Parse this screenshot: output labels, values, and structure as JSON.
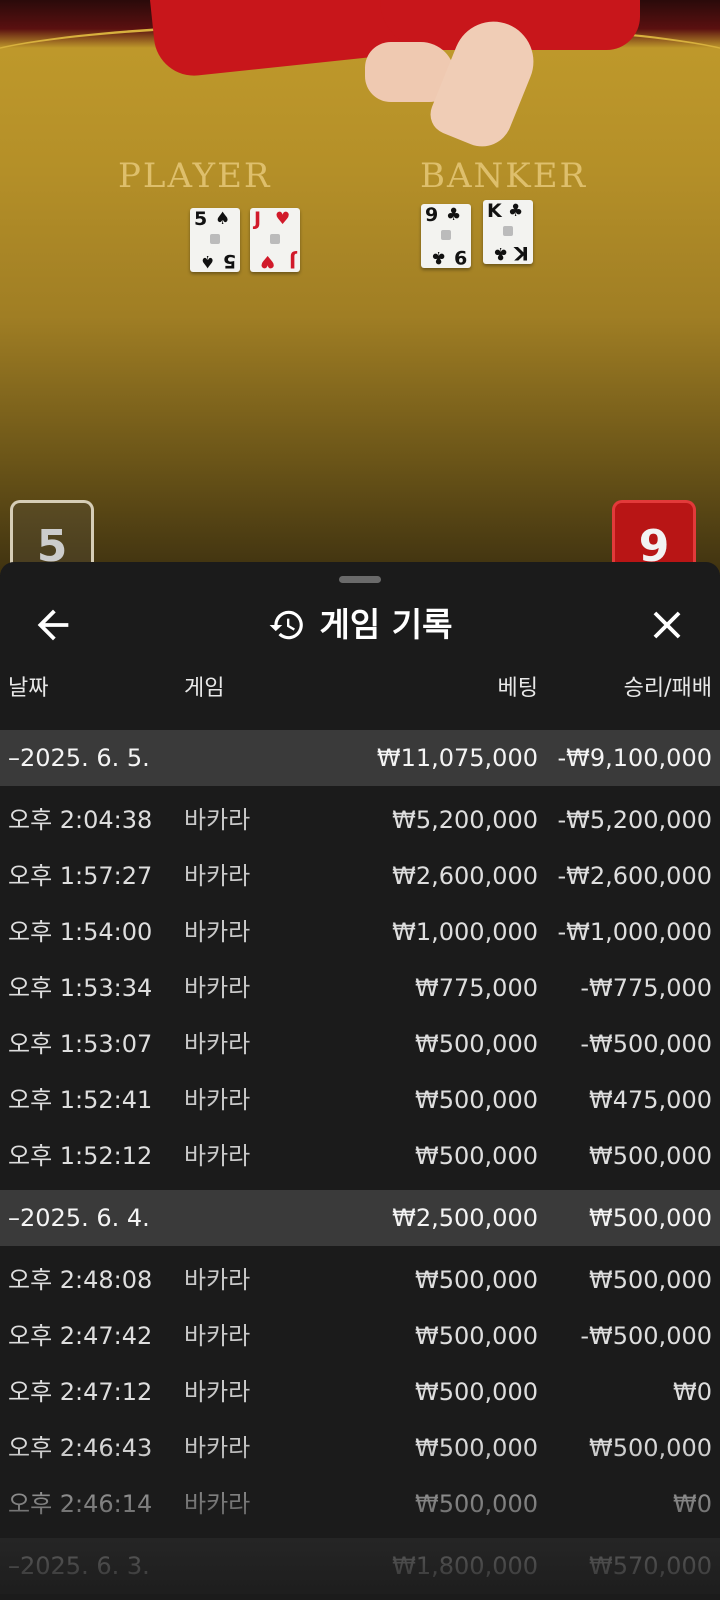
{
  "video": {
    "player_label": "PLAYER",
    "banker_label": "BANKER",
    "player_cards": [
      {
        "rank": "5",
        "suit": "♠",
        "color": "black"
      },
      {
        "rank": "J",
        "suit": "♥",
        "color": "red"
      }
    ],
    "banker_cards": [
      {
        "rank": "9",
        "suit": "♣",
        "color": "black"
      },
      {
        "rank": "K",
        "suit": "♣",
        "color": "black"
      }
    ],
    "player_score": "5",
    "banker_score": "9"
  },
  "sheet": {
    "title": "게임 기록",
    "title_icon": "history-icon",
    "back_icon": "arrow-left-icon",
    "close_icon": "close-icon",
    "columns": {
      "date": "날짜",
      "game": "게임",
      "bet": "베팅",
      "win_loss": "승리/패배"
    },
    "groups": [
      {
        "date": "–2025. 6. 5.",
        "bet": "₩11,075,000",
        "win_loss": "-₩9,100,000",
        "rows": [
          {
            "time": "오후 2:04:38",
            "game": "바카라",
            "bet": "₩5,200,000",
            "win_loss": "-₩5,200,000"
          },
          {
            "time": "오후 1:57:27",
            "game": "바카라",
            "bet": "₩2,600,000",
            "win_loss": "-₩2,600,000"
          },
          {
            "time": "오후 1:54:00",
            "game": "바카라",
            "bet": "₩1,000,000",
            "win_loss": "-₩1,000,000"
          },
          {
            "time": "오후 1:53:34",
            "game": "바카라",
            "bet": "₩775,000",
            "win_loss": "-₩775,000"
          },
          {
            "time": "오후 1:53:07",
            "game": "바카라",
            "bet": "₩500,000",
            "win_loss": "-₩500,000"
          },
          {
            "time": "오후 1:52:41",
            "game": "바카라",
            "bet": "₩500,000",
            "win_loss": "₩475,000"
          },
          {
            "time": "오후 1:52:12",
            "game": "바카라",
            "bet": "₩500,000",
            "win_loss": "₩500,000"
          }
        ]
      },
      {
        "date": "–2025. 6. 4.",
        "bet": "₩2,500,000",
        "win_loss": "₩500,000",
        "rows": [
          {
            "time": "오후 2:48:08",
            "game": "바카라",
            "bet": "₩500,000",
            "win_loss": "₩500,000"
          },
          {
            "time": "오후 2:47:42",
            "game": "바카라",
            "bet": "₩500,000",
            "win_loss": "-₩500,000"
          },
          {
            "time": "오후 2:47:12",
            "game": "바카라",
            "bet": "₩500,000",
            "win_loss": "₩0"
          },
          {
            "time": "오후 2:46:43",
            "game": "바카라",
            "bet": "₩500,000",
            "win_loss": "₩500,000"
          },
          {
            "time": "오후 2:46:14",
            "game": "바카라",
            "bet": "₩500,000",
            "win_loss": "₩0"
          }
        ]
      },
      {
        "date": "–2025. 6. 3.",
        "bet": "₩1,800,000",
        "win_loss": "₩570,000",
        "rows": []
      }
    ]
  }
}
